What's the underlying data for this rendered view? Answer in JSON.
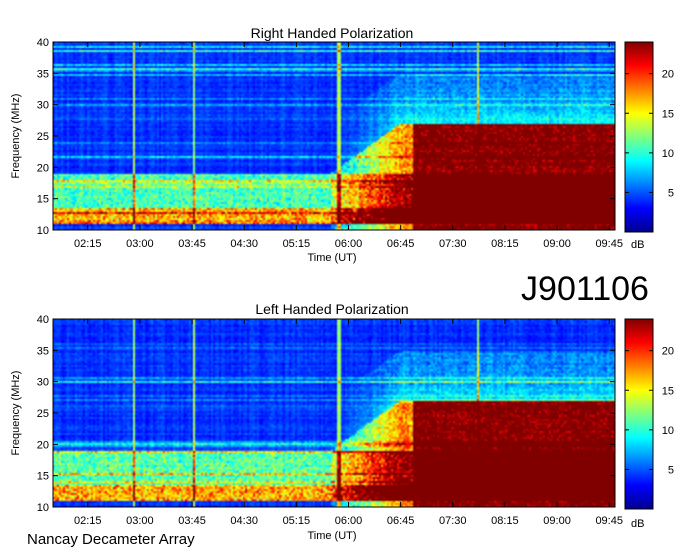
{
  "main_label": "J901106",
  "footer": "Nancay Decameter Array",
  "chart_data": [
    {
      "type": "heatmap",
      "title": "Right Handed Polarization",
      "xlabel": "Time (UT)",
      "ylabel": "Frequency (MHz)",
      "x_ticks": [
        "02:15",
        "03:00",
        "03:45",
        "04:30",
        "05:15",
        "06:00",
        "06:45",
        "07:30",
        "08:15",
        "09:00",
        "09:45"
      ],
      "xlim": [
        "01:45",
        "09:50"
      ],
      "y_ticks": [
        10,
        15,
        20,
        25,
        30,
        35,
        40
      ],
      "ylim": [
        10,
        40
      ],
      "colorbar": {
        "label": "dB",
        "ticks": [
          5,
          10,
          15,
          20
        ],
        "range": [
          0,
          24
        ]
      },
      "features": {
        "emission_start_time": "05:45",
        "strong_emission_start": "06:55",
        "low_freq_band_mhz": [
          11,
          19
        ],
        "high_freq_extent_mhz": 27,
        "interference_lines_time": [
          "02:55",
          "03:47",
          "05:52",
          "07:52"
        ]
      }
    },
    {
      "type": "heatmap",
      "title": "Left Handed Polarization",
      "xlabel": "Time (UT)",
      "ylabel": "Frequency (MHz)",
      "x_ticks": [
        "02:15",
        "03:00",
        "03:45",
        "04:30",
        "05:15",
        "06:00",
        "06:45",
        "07:30",
        "08:15",
        "09:00",
        "09:45"
      ],
      "xlim": [
        "01:45",
        "09:50"
      ],
      "y_ticks": [
        10,
        15,
        20,
        25,
        30,
        35,
        40
      ],
      "ylim": [
        10,
        40
      ],
      "colorbar": {
        "label": "dB",
        "ticks": [
          5,
          10,
          15,
          20
        ],
        "range": [
          0,
          24
        ]
      },
      "features": {
        "emission_start_time": "05:45",
        "strong_emission_start": "06:55",
        "low_freq_band_mhz": [
          11,
          19
        ],
        "high_freq_extent_mhz": 27,
        "interference_lines_time": [
          "02:55",
          "03:47",
          "05:52",
          "07:52"
        ]
      }
    }
  ]
}
